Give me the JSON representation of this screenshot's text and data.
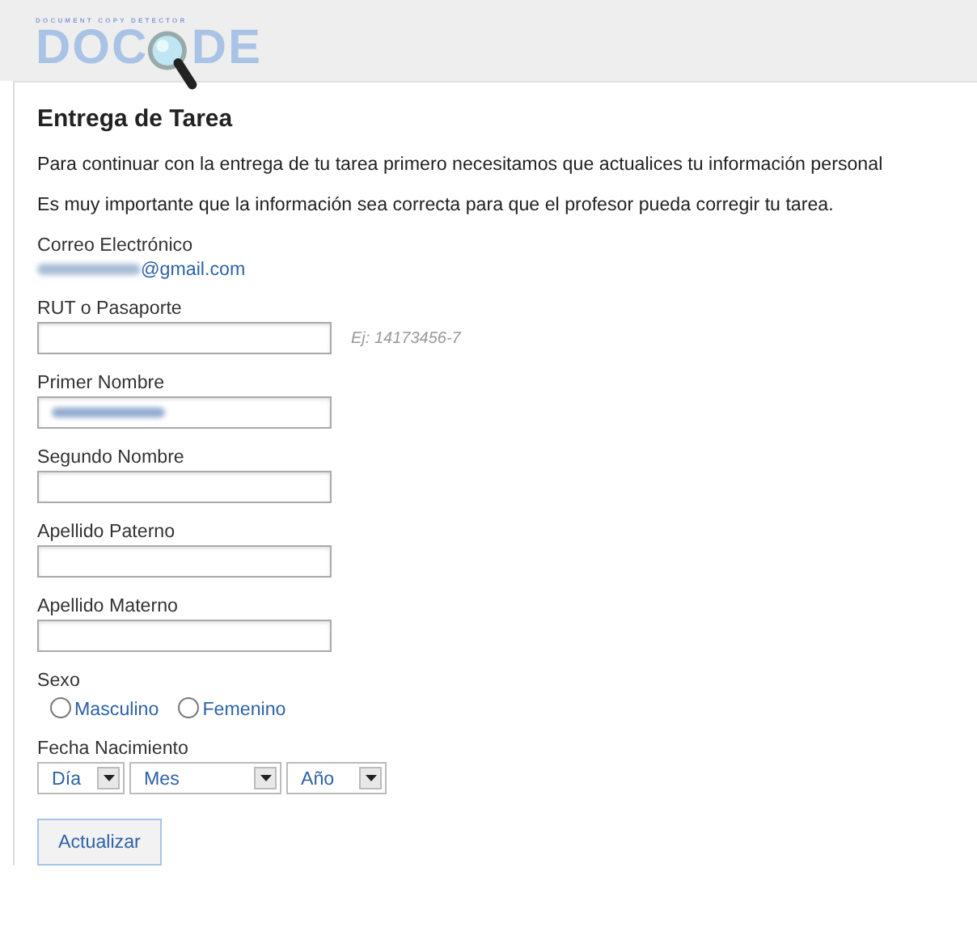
{
  "logo": {
    "tagline": "DOCUMENT COPY DETECTOR",
    "text_left": "DOC",
    "text_right": "DE"
  },
  "title": "Entrega de Tarea",
  "paragraphs": [
    "Para continuar con la entrega de tu tarea primero necesitamos que actualices tu información personal",
    "Es muy importante que la información sea correcta para que el profesor pueda corregir tu tarea."
  ],
  "fields": [
    {
      "kind": "email",
      "label": "Correo Electrónico",
      "value": "@gmail.com",
      "redacted": true
    },
    {
      "kind": "text",
      "label": "RUT o Pasaporte",
      "hint": "Ej: 14173456-7",
      "redacted": false
    },
    {
      "kind": "text",
      "label": "Primer Nombre",
      "redacted": true
    },
    {
      "kind": "text",
      "label": "Segundo Nombre",
      "redacted": false
    },
    {
      "kind": "text",
      "label": "Apellido Paterno",
      "redacted": false
    },
    {
      "kind": "text",
      "label": "Apellido Materno",
      "redacted": false
    },
    {
      "kind": "radio",
      "label": "Sexo",
      "options": [
        {
          "label": "Masculino",
          "selected": false
        },
        {
          "label": "Femenino",
          "selected": false
        }
      ]
    },
    {
      "kind": "date",
      "label": "Fecha Nacimiento",
      "selects": [
        {
          "label": "Día"
        },
        {
          "label": "Mes"
        },
        {
          "label": "Año"
        }
      ]
    }
  ],
  "submit": "Actualizar"
}
